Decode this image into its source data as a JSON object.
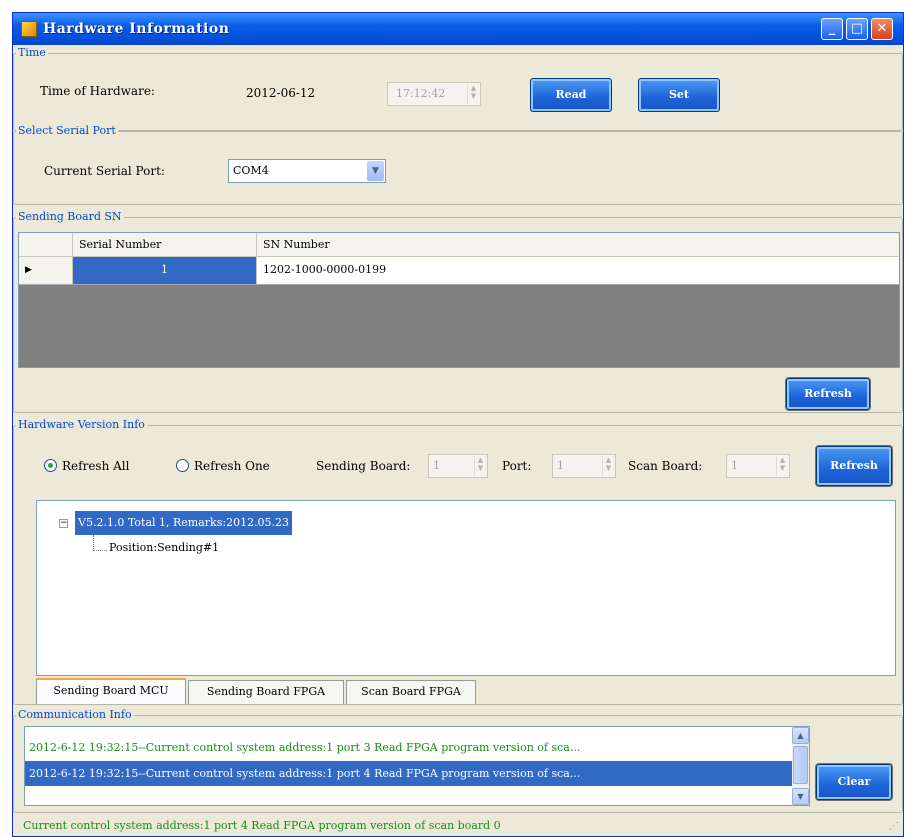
{
  "window": {
    "title": "Hardware Information"
  },
  "time_group": {
    "label": "Time",
    "time_of_hardware_label": "Time of Hardware:",
    "date_value": "2012-06-12",
    "time_value": "17:12:42",
    "read_button": "Read",
    "set_button": "Set"
  },
  "serial_group": {
    "label": "Select Serial Port",
    "current_port_label": "Current Serial Port:",
    "current_port_value": "COM4"
  },
  "sn_group": {
    "label": "Sending Board SN",
    "columns": [
      "Serial Number",
      "SN Number"
    ],
    "rows": [
      {
        "serial": "1",
        "sn": "1202-1000-0000-0199"
      }
    ],
    "refresh_button": "Refresh"
  },
  "version_group": {
    "label": "Hardware Version Info",
    "refresh_all": "Refresh All",
    "refresh_one": "Refresh One",
    "sending_board_label": "Sending Board:",
    "sending_board_value": "1",
    "port_label": "Port:",
    "port_value": "1",
    "scan_board_label": "Scan Board:",
    "scan_board_value": "1",
    "refresh_button": "Refresh",
    "tree": {
      "root": "V5.2.1.0 Total 1, Remarks:2012.05.23",
      "child": "Position:Sending#1"
    },
    "tabs": [
      "Sending Board MCU",
      "Sending Board FPGA",
      "Scan Board FPGA"
    ]
  },
  "comm_group": {
    "label": "Communication Info",
    "lines": [
      "2012-6-12 19:32:15--Current control system address:1 port 3 Read FPGA program version of sca...",
      "2012-6-12 19:32:15--Current control system address:1 port 4 Read FPGA program version of sca..."
    ],
    "clear_button": "Clear"
  },
  "status": {
    "text": "Current control system address:1 port 4 Read FPGA program version of scan board 0"
  },
  "colors": {
    "accent": "#0a5ce6",
    "selection": "#316ac5",
    "log_text": "#1a8a1a"
  }
}
